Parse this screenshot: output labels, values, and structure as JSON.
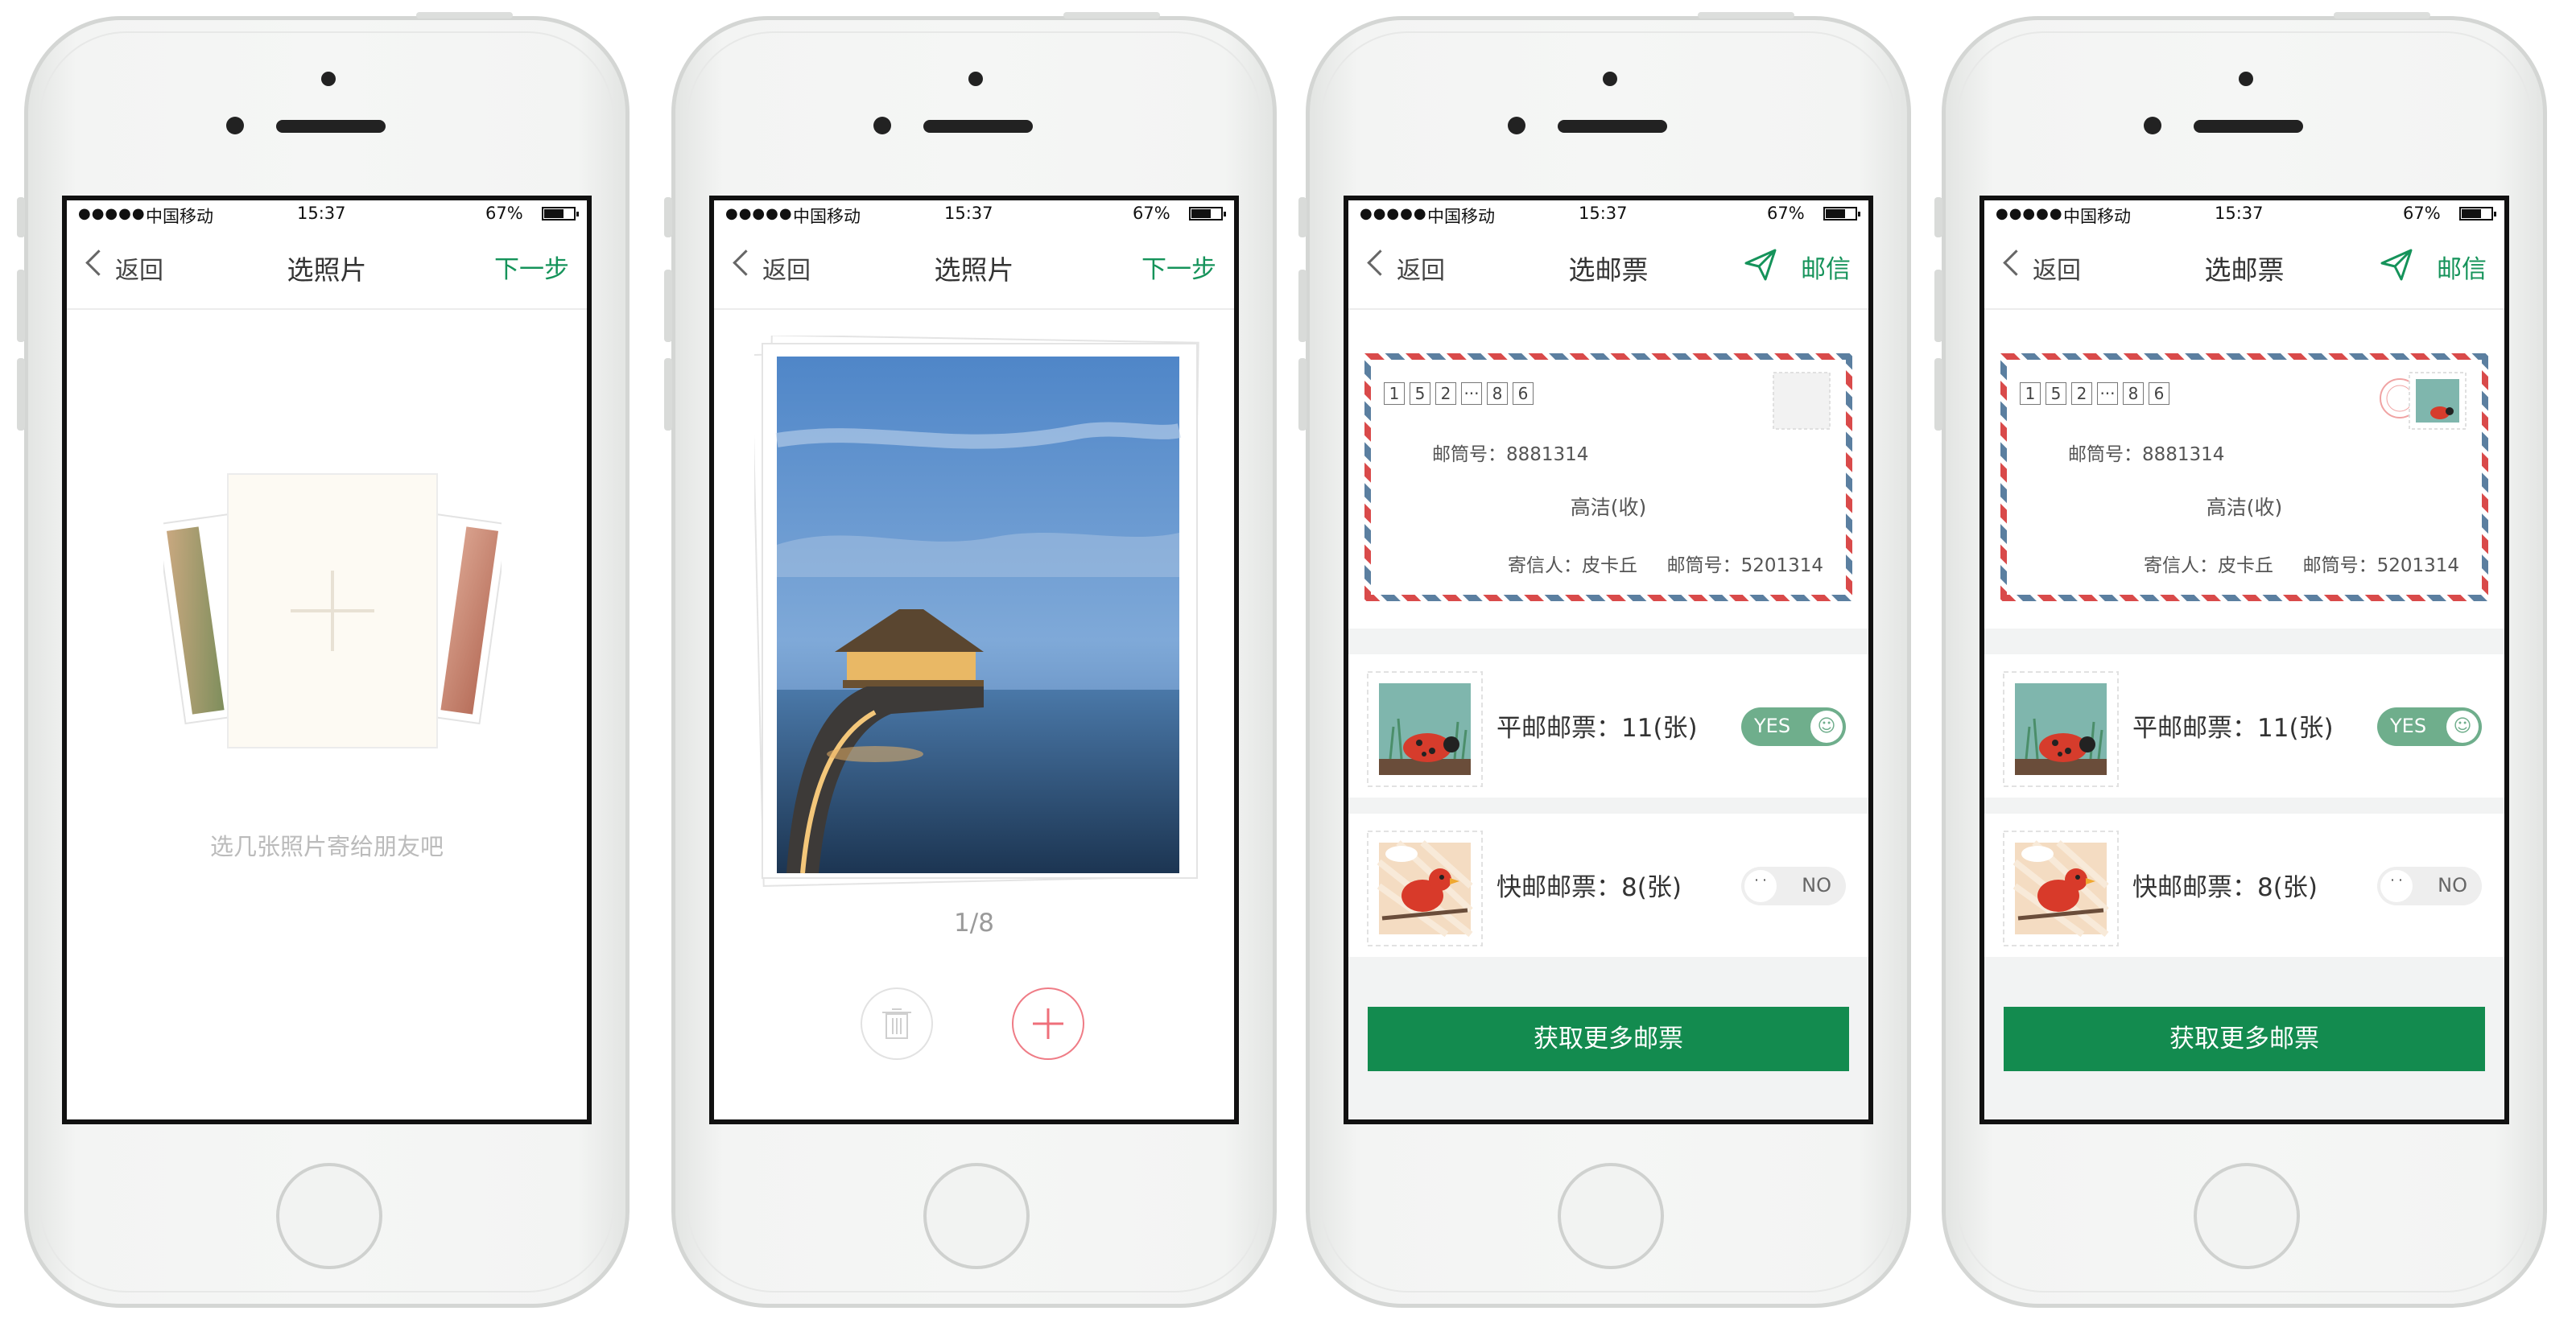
{
  "status_bar": {
    "signal": "●●●●●",
    "carrier": "中国移动",
    "time": "15:37",
    "battery": "67%",
    "battery_level": 0.67
  },
  "screens": [
    {
      "nav": {
        "back": "返回",
        "title": "选照片",
        "action": "下一步"
      },
      "empty_hint": "选几张照片寄给朋友吧"
    },
    {
      "nav": {
        "back": "返回",
        "title": "选照片",
        "action": "下一步"
      },
      "page_counter": "1/8"
    },
    {
      "nav": {
        "back": "返回",
        "title": "选邮票",
        "action": "邮信"
      },
      "envelope": {
        "zip_digits": [
          "1",
          "5",
          "2",
          "···",
          "8",
          "6"
        ],
        "mailbox_label": "邮筒号：8881314",
        "recipient": "高洁(收)",
        "sender": "寄信人：皮卡丘",
        "sender_mailbox": "邮筒号：5201314"
      },
      "stamps": [
        {
          "label": "平邮邮票：11(张)",
          "toggle": "YES"
        },
        {
          "label": "快邮邮票：8(张)",
          "toggle": "NO"
        }
      ],
      "cta": "获取更多邮票"
    },
    {
      "nav": {
        "back": "返回",
        "title": "选邮票",
        "action": "邮信"
      },
      "envelope": {
        "zip_digits": [
          "1",
          "5",
          "2",
          "···",
          "8",
          "6"
        ],
        "mailbox_label": "邮筒号：8881314",
        "recipient": "高洁(收)",
        "sender": "寄信人：皮卡丘",
        "sender_mailbox": "邮筒号：5201314"
      },
      "stamps": [
        {
          "label": "平邮邮票：11(张)",
          "toggle": "YES"
        },
        {
          "label": "快邮邮票：8(张)",
          "toggle": "NO"
        }
      ],
      "cta": "获取更多邮票"
    }
  ]
}
